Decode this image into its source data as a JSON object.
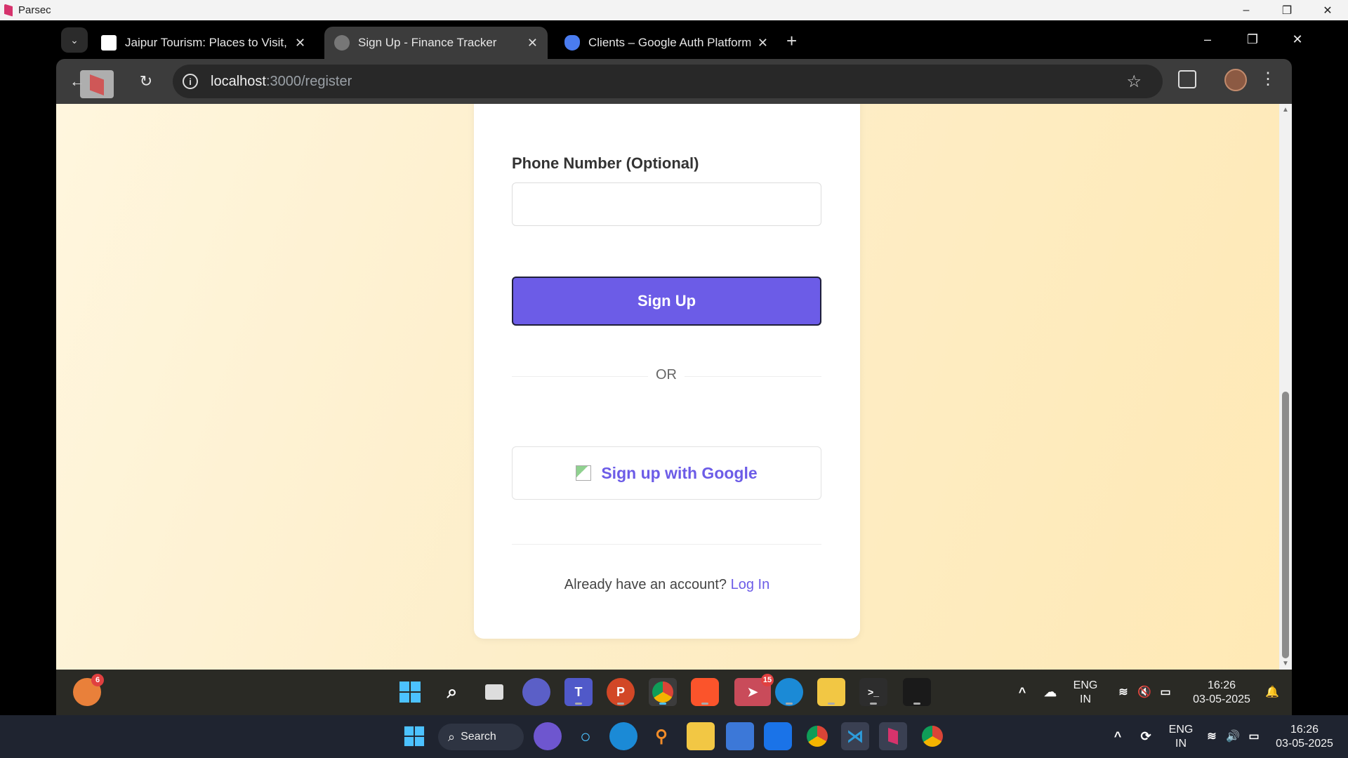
{
  "parsec": {
    "title": "Parsec",
    "controls": [
      "–",
      "❐",
      "✕"
    ]
  },
  "tabs": [
    {
      "title": "Jaipur Tourism: Places to Visit, S",
      "active": false
    },
    {
      "title": "Sign Up - Finance Tracker",
      "active": true
    },
    {
      "title": "Clients – Google Auth Platform",
      "active": false
    }
  ],
  "new_tab": "+",
  "window_controls": [
    "–",
    "❐",
    "✕"
  ],
  "address": {
    "host": "localhost",
    "path": ":3000/register"
  },
  "form": {
    "phone_label": "Phone Number (Optional)",
    "phone_value": "",
    "signup_label": "Sign Up",
    "or_label": "OR",
    "google_label": "Sign up with Google",
    "account_prompt": "Already have an account?",
    "login_link": "Log In"
  },
  "inner_taskbar": {
    "weather_badge": "6",
    "telegram_badge": "15",
    "lang": "ENG",
    "region": "IN",
    "time": "16:26",
    "date": "03-05-2025"
  },
  "outer_taskbar": {
    "search_label": "Search",
    "lang": "ENG",
    "region": "IN",
    "time": "16:26",
    "date": "03-05-2025"
  },
  "colors": {
    "accent": "#6c5ce7",
    "page_bg": "#fdeec9"
  }
}
